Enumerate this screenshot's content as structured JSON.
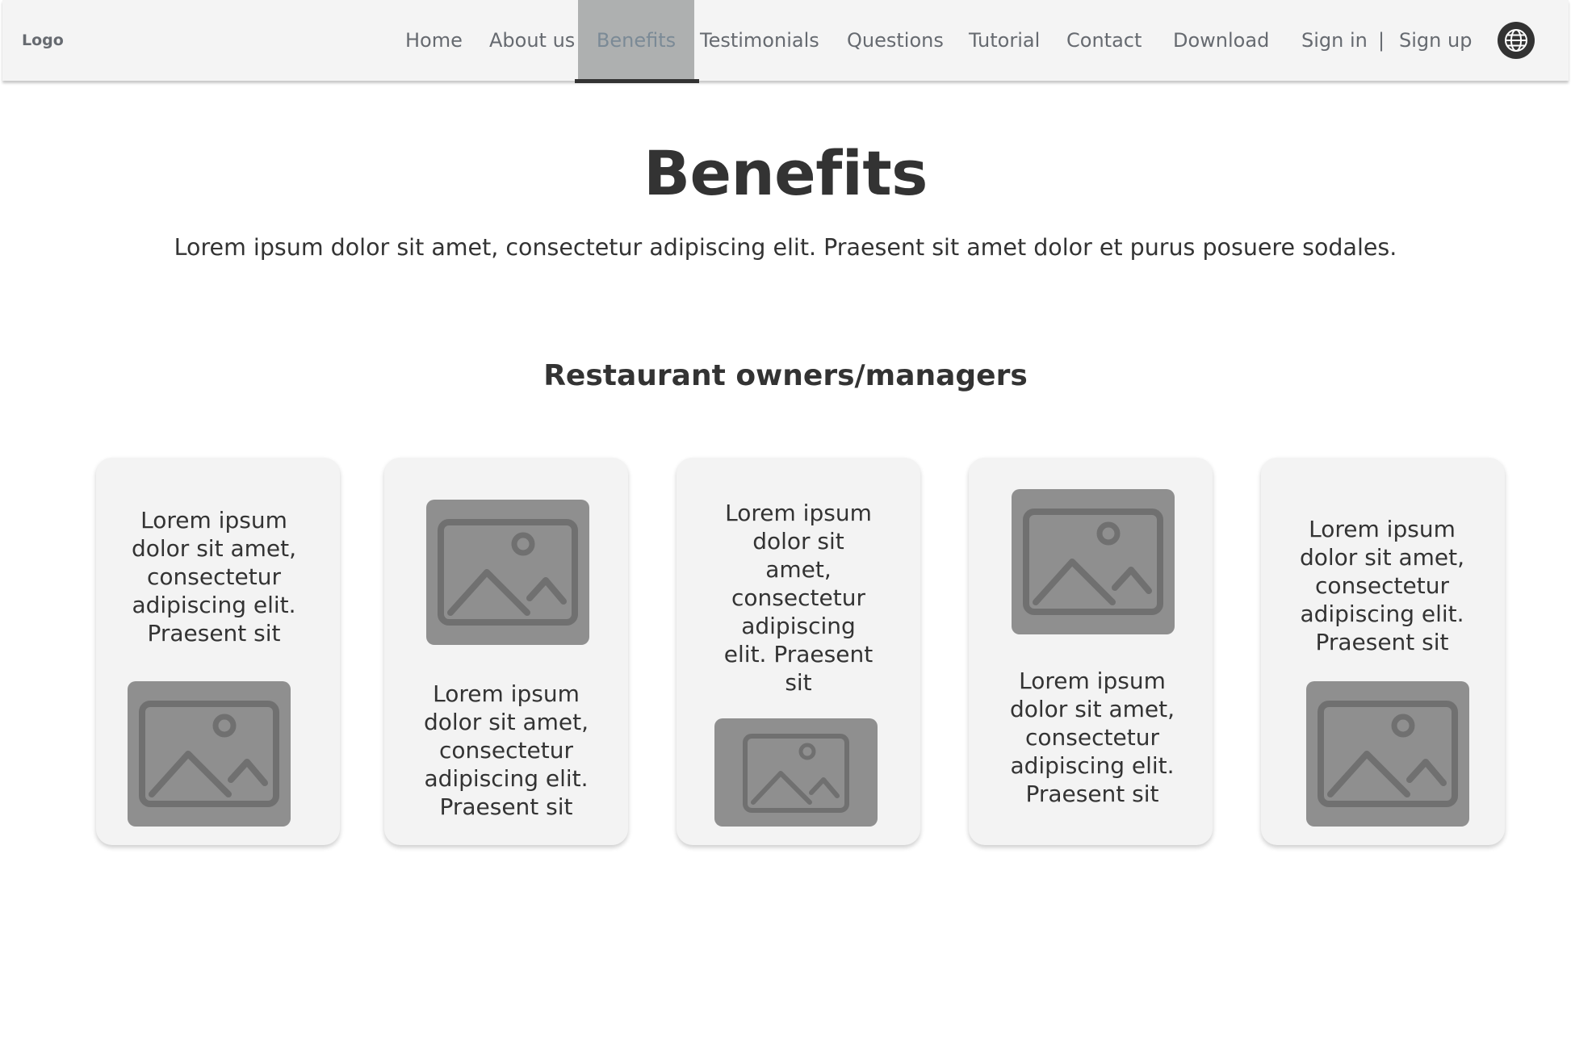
{
  "nav": {
    "logo": "Logo",
    "links": [
      "Home",
      "About us",
      "Benefits",
      "Testimonials",
      "Questions",
      "Tutorial",
      "Contact",
      "Download"
    ],
    "sign_in": "Sign in",
    "separator": "|",
    "sign_up": "Sign up",
    "globe_icon": "globe-icon",
    "active_link": "Benefits"
  },
  "hero": {
    "title": "Benefits",
    "subtitle": "Lorem ipsum dolor sit amet, consectetur adipiscing elit. Praesent sit amet dolor et purus posuere sodales."
  },
  "section": {
    "title": "Restaurant owners/managers"
  },
  "cards": [
    {
      "text": "Lorem ipsum dolor sit amet, consectetur adipiscing elit. Praesent sit",
      "image_icon": "image-placeholder-icon"
    },
    {
      "text": "Lorem ipsum dolor sit amet, consectetur adipiscing elit. Praesent sit",
      "image_icon": "image-placeholder-icon"
    },
    {
      "text": "Lorem ipsum dolor sit amet, consectetur adipiscing elit. Praesent sit",
      "image_icon": "image-placeholder-icon"
    },
    {
      "text": "Lorem ipsum dolor sit amet, consectetur adipiscing elit. Praesent sit",
      "image_icon": "image-placeholder-icon"
    },
    {
      "text": "Lorem ipsum dolor sit amet, consectetur adipiscing elit. Praesent sit",
      "image_icon": "image-placeholder-icon"
    }
  ],
  "colors": {
    "nav_bg": "#f4f4f4",
    "nav_active_bg": "#aeb0b0",
    "text": "#333333",
    "card_bg": "#f3f3f3",
    "image_placeholder": "#8f8f8f"
  }
}
